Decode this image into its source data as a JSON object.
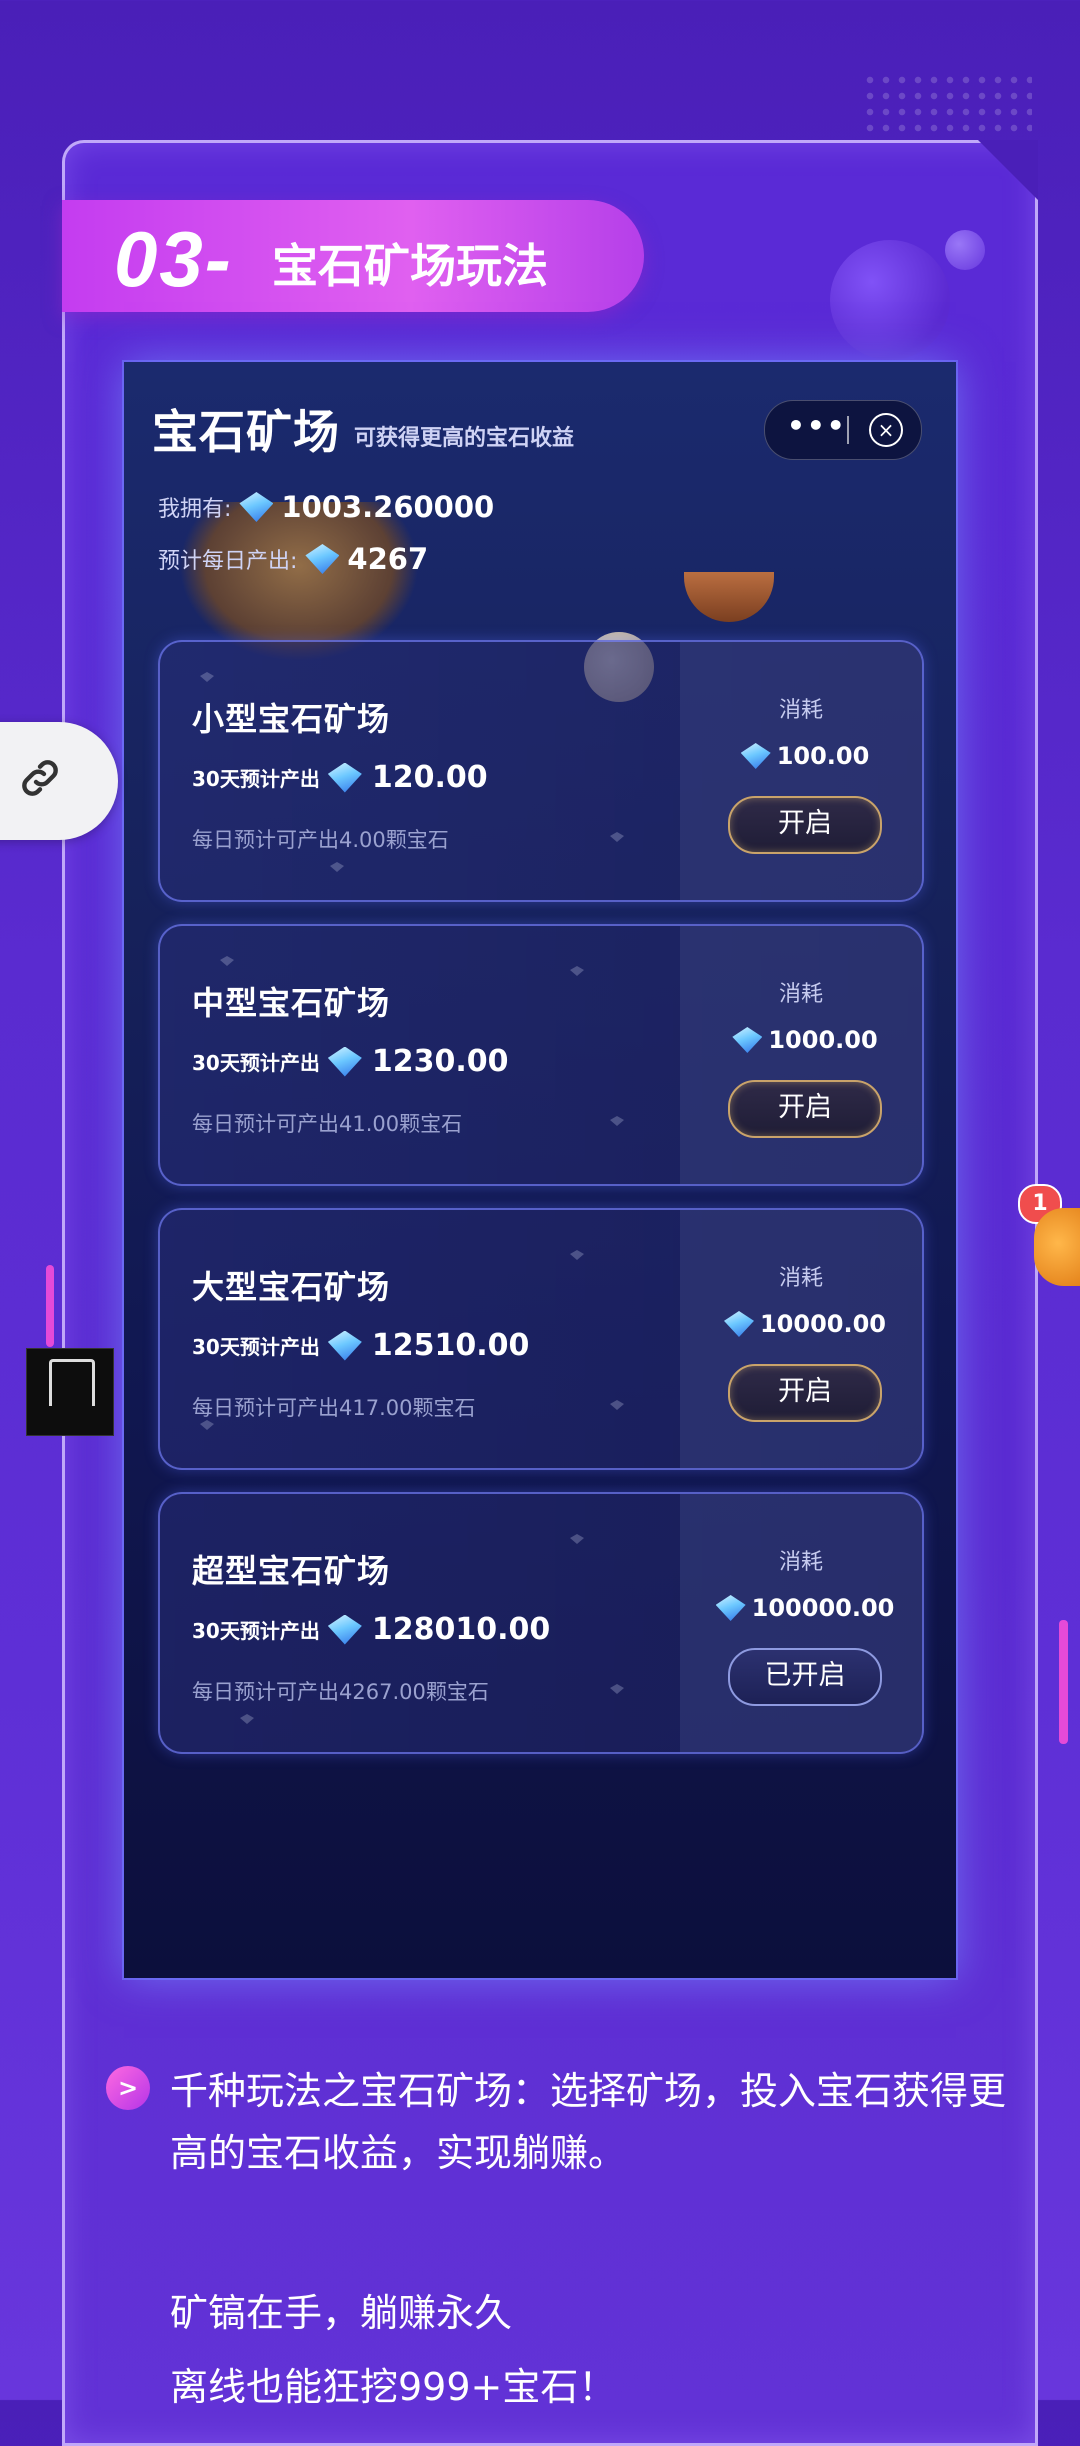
{
  "section": {
    "number": "03-",
    "title": "宝石矿场玩法"
  },
  "mini_app": {
    "title": "宝石矿场",
    "subtitle": "可获得更高的宝石收益",
    "capsule": {
      "more": "•••",
      "close": "⊗"
    },
    "owned_label": "我拥有:",
    "owned_value": "1003.260000",
    "daily_output_label": "预计每日产出:",
    "daily_output_value": "4267"
  },
  "mines": [
    {
      "name": "小型宝石矿场",
      "estimate_label": "30天预计产出",
      "estimate_value": "120.00",
      "daily_text": "每日预计可产出4.00颗宝石",
      "cost_label": "消耗",
      "cost_value": "100.00",
      "button": "开启"
    },
    {
      "name": "中型宝石矿场",
      "estimate_label": "30天预计产出",
      "estimate_value": "1230.00",
      "daily_text": "每日预计可产出41.00颗宝石",
      "cost_label": "消耗",
      "cost_value": "1000.00",
      "button": "开启"
    },
    {
      "name": "大型宝石矿场",
      "estimate_label": "30天预计产出",
      "estimate_value": "12510.00",
      "daily_text": "每日预计可产出417.00颗宝石",
      "cost_label": "消耗",
      "cost_value": "10000.00",
      "button": "开启"
    },
    {
      "name": "超型宝石矿场",
      "estimate_label": "30天预计产出",
      "estimate_value": "128010.00",
      "daily_text": "每日预计可产出4267.00颗宝石",
      "cost_label": "消耗",
      "cost_value": "100000.00",
      "button": "已开启"
    }
  ],
  "notification_badge": "1",
  "description": {
    "bullet_icon": ">",
    "text": "千种玩法之宝石矿场：选择矿场，投入宝石获得更高的宝石收益，实现躺赚。",
    "slogan_line1": "矿镐在手，躺赚永久",
    "slogan_line2": "离线也能狂挖999+宝石！"
  }
}
